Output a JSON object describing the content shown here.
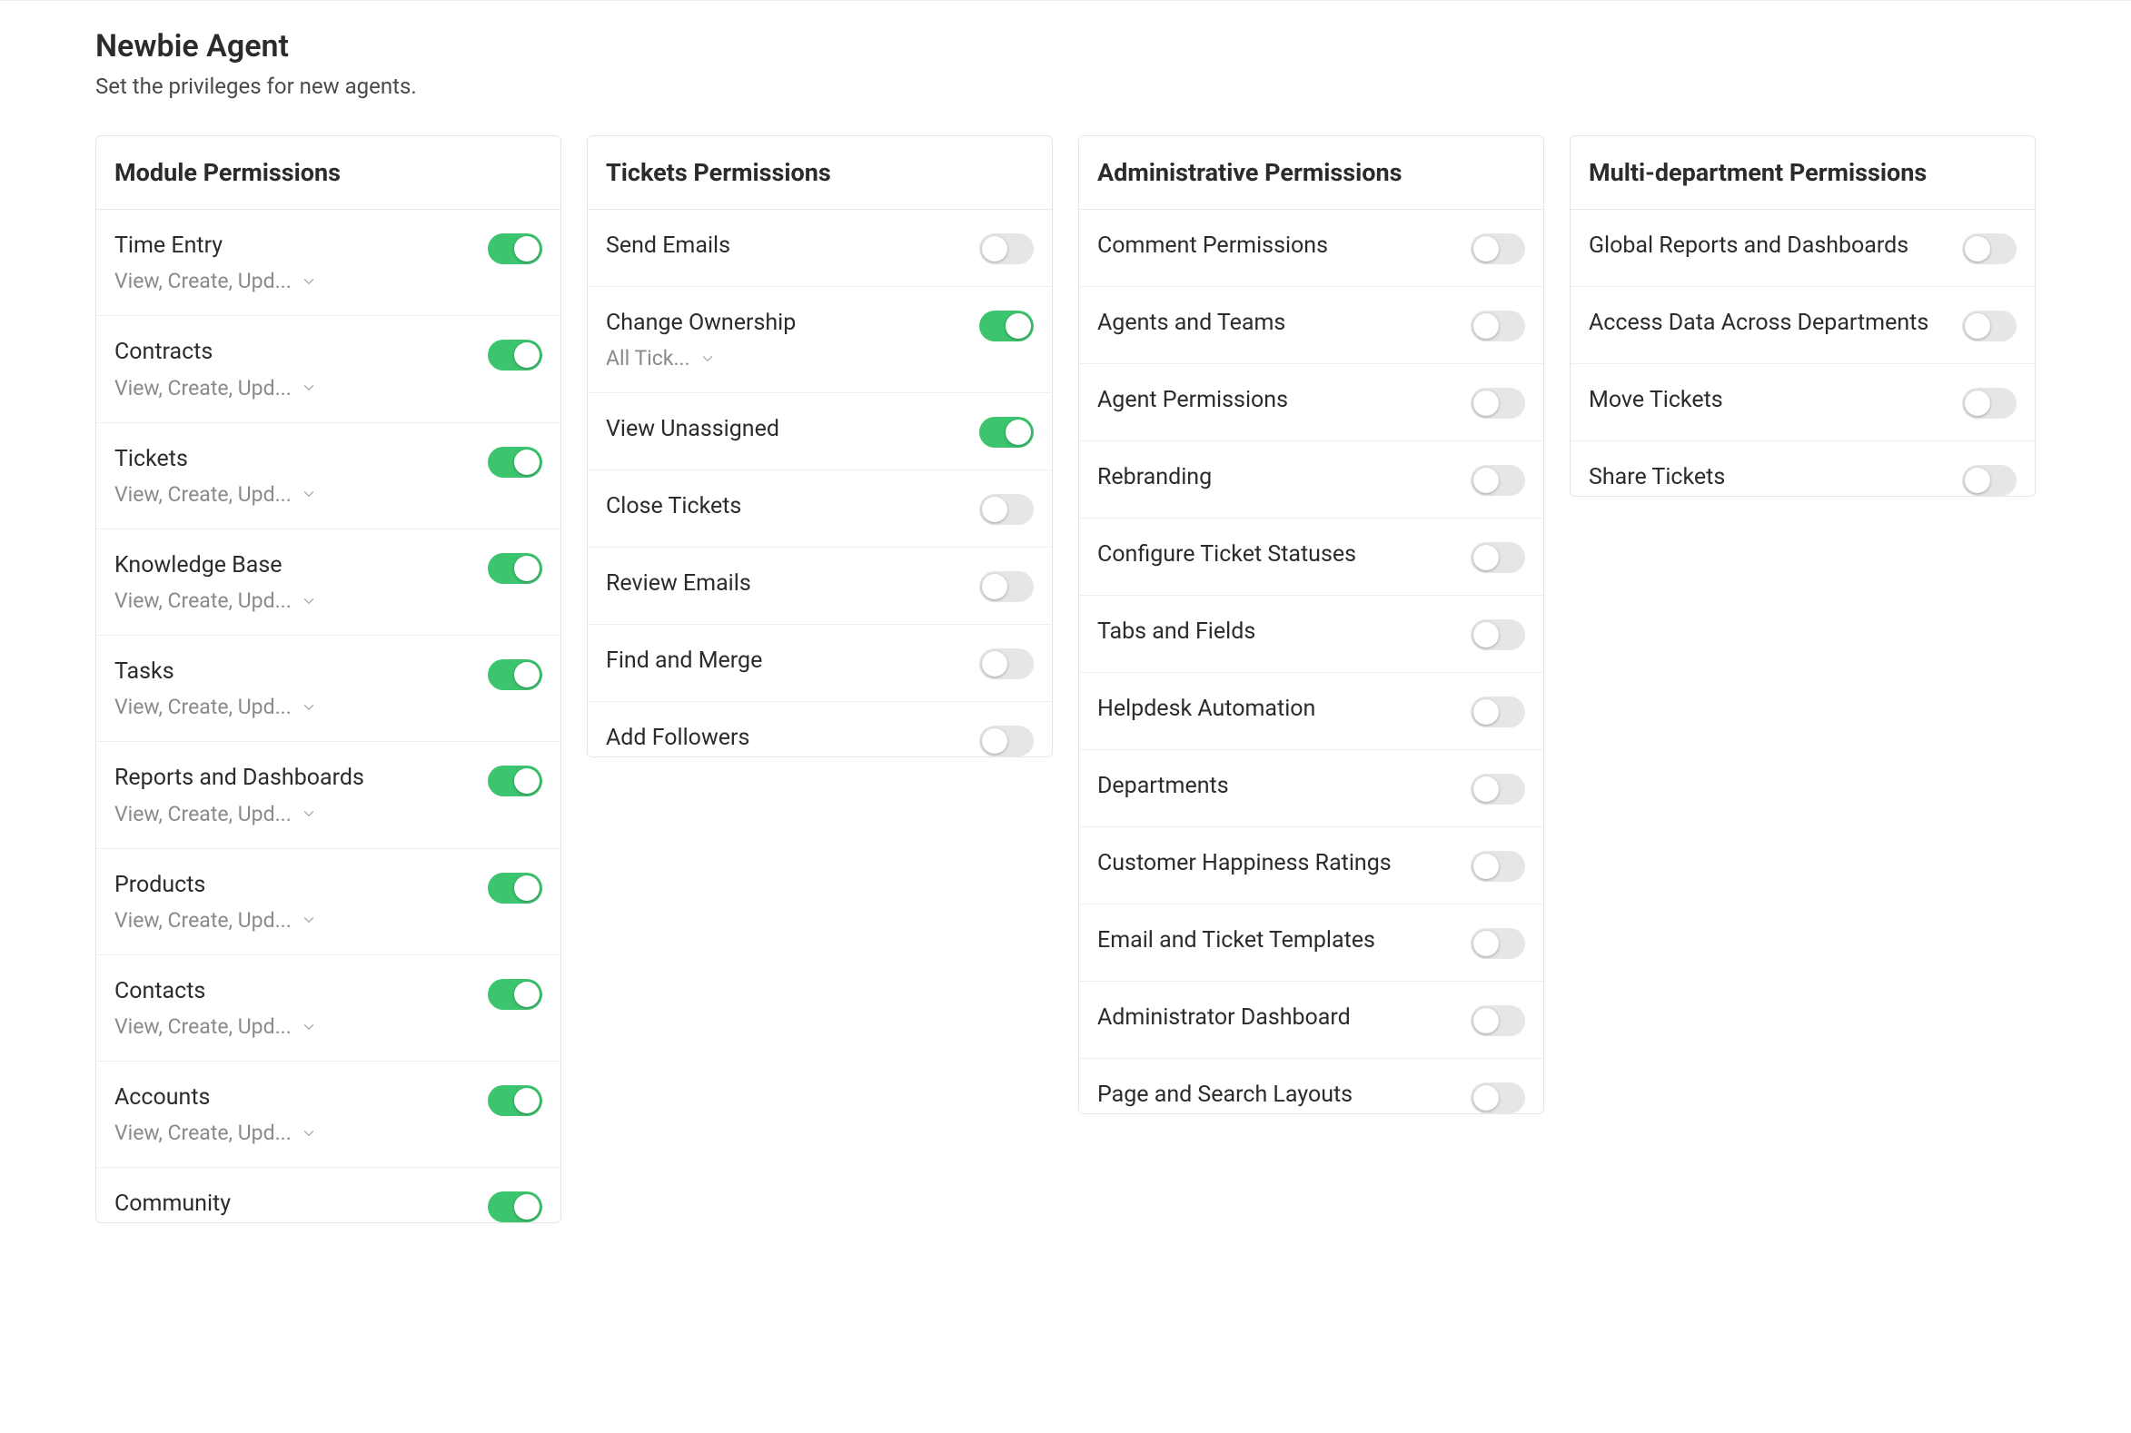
{
  "header": {
    "title": "Newbie Agent",
    "subtitle": "Set the privileges for new agents."
  },
  "columns": [
    {
      "id": "module",
      "title": "Module Permissions",
      "items": [
        {
          "id": "time-entry",
          "title": "Time Entry",
          "sub": "View, Create, Upd...",
          "dropdown": true,
          "on": true
        },
        {
          "id": "contracts",
          "title": "Contracts",
          "sub": "View, Create, Upd...",
          "dropdown": true,
          "on": true
        },
        {
          "id": "tickets",
          "title": "Tickets",
          "sub": "View, Create, Upd...",
          "dropdown": true,
          "on": true
        },
        {
          "id": "knowledge-base",
          "title": "Knowledge Base",
          "sub": "View, Create, Upd...",
          "dropdown": true,
          "on": true
        },
        {
          "id": "tasks",
          "title": "Tasks",
          "sub": "View, Create, Upd...",
          "dropdown": true,
          "on": true
        },
        {
          "id": "reports-dashboards",
          "title": "Reports and Dashboards",
          "sub": "View, Create, Upd...",
          "dropdown": true,
          "on": true
        },
        {
          "id": "products",
          "title": "Products",
          "sub": "View, Create, Upd...",
          "dropdown": true,
          "on": true
        },
        {
          "id": "contacts",
          "title": "Contacts",
          "sub": "View, Create, Upd...",
          "dropdown": true,
          "on": true
        },
        {
          "id": "accounts",
          "title": "Accounts",
          "sub": "View, Create, Upd...",
          "dropdown": true,
          "on": true
        },
        {
          "id": "community",
          "title": "Community",
          "on": true
        }
      ]
    },
    {
      "id": "tickets",
      "title": "Tickets Permissions",
      "items": [
        {
          "id": "send-emails",
          "title": "Send Emails",
          "on": false
        },
        {
          "id": "change-ownership",
          "title": "Change Ownership",
          "sub": "All Tick...",
          "dropdown": true,
          "on": true
        },
        {
          "id": "view-unassigned",
          "title": "View Unassigned",
          "on": true
        },
        {
          "id": "close-tickets",
          "title": "Close Tickets",
          "on": false
        },
        {
          "id": "review-emails",
          "title": "Review Emails",
          "on": false
        },
        {
          "id": "find-merge",
          "title": "Find and Merge",
          "on": false
        },
        {
          "id": "add-followers",
          "title": "Add Followers",
          "on": false
        }
      ]
    },
    {
      "id": "admin",
      "title": "Administrative Permissions",
      "items": [
        {
          "id": "comment-permissions",
          "title": "Comment Permissions",
          "on": false
        },
        {
          "id": "agents-teams",
          "title": "Agents and Teams",
          "on": false
        },
        {
          "id": "agent-permissions",
          "title": "Agent Permissions",
          "on": false
        },
        {
          "id": "rebranding",
          "title": "Rebranding",
          "on": false
        },
        {
          "id": "configure-ticket-statuses",
          "title": "Configure Ticket Statuses",
          "on": false
        },
        {
          "id": "tabs-fields",
          "title": "Tabs and Fields",
          "on": false
        },
        {
          "id": "helpdesk-automation",
          "title": "Helpdesk Automation",
          "on": false
        },
        {
          "id": "departments",
          "title": "Departments",
          "on": false
        },
        {
          "id": "customer-happiness",
          "title": "Customer Happiness Ratings",
          "on": false
        },
        {
          "id": "email-ticket-templates",
          "title": "Email and Ticket Templates",
          "on": false
        },
        {
          "id": "admin-dashboard",
          "title": "Administrator Dashboard",
          "on": false
        },
        {
          "id": "page-search-layouts",
          "title": "Page and Search Layouts",
          "on": false
        }
      ]
    },
    {
      "id": "multi",
      "title": "Multi-department Permissions",
      "items": [
        {
          "id": "global-reports",
          "title": "Global Reports and Dashboards",
          "on": false
        },
        {
          "id": "access-data-across",
          "title": "Access Data Across Departments",
          "on": false
        },
        {
          "id": "move-tickets",
          "title": "Move Tickets",
          "on": false
        },
        {
          "id": "share-tickets",
          "title": "Share Tickets",
          "on": false
        }
      ]
    }
  ]
}
